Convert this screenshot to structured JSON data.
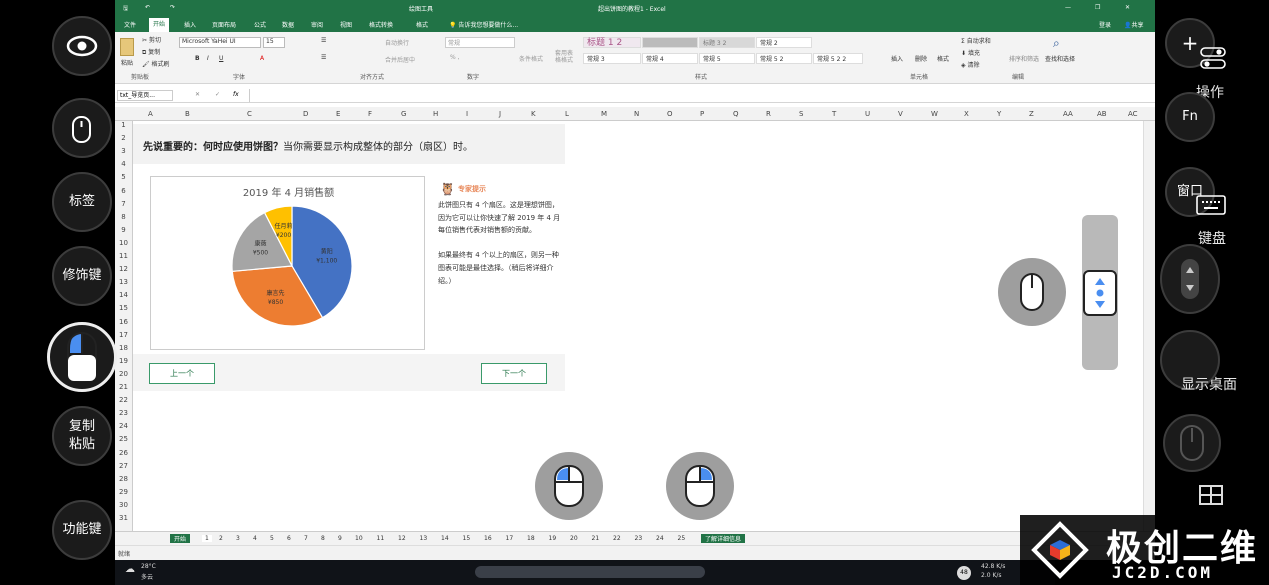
{
  "titlebar": {
    "context_tab": "绘图工具",
    "doc_title": "超出饼图的教程1 - Excel",
    "login": "登录",
    "share": "共享"
  },
  "ribbon_tabs": [
    "文件",
    "开始",
    "插入",
    "页面布局",
    "公式",
    "数据",
    "审阅",
    "视图",
    "格式转换",
    "格式"
  ],
  "tell_me": "告诉我您想要做什么...",
  "ribbon": {
    "clipboard": {
      "paste": "粘贴",
      "cut": "剪切",
      "copy": "复制",
      "format_painter": "格式刷",
      "label": "剪贴板"
    },
    "font": {
      "name": "Microsoft YaHei UI",
      "size": "15",
      "label": "字体"
    },
    "alignment": {
      "wrap": "自动换行",
      "merge": "合并后居中",
      "label": "对齐方式"
    },
    "number": {
      "format": "常规",
      "label": "数字"
    },
    "styles": {
      "conditional": "条件格式",
      "as_table": "套用表格格式",
      "cells": [
        "标题 1 2",
        "",
        "标题 3 2",
        "常规 2",
        "常规 3",
        "常规 4",
        "常规 5",
        "常规 5 2",
        "常规 5 2 2"
      ],
      "label": "样式"
    },
    "cells_group": {
      "insert": "插入",
      "delete": "删除",
      "format": "格式",
      "label": "单元格"
    },
    "editing": {
      "autosum": "自动求和",
      "fill": "填充",
      "clear": "清除",
      "sort": "排序和筛选",
      "find": "查找和选择",
      "label": "编辑"
    }
  },
  "formula_bar": {
    "name_box": "txt_导览页...",
    "fx": "fx"
  },
  "columns": [
    "A",
    "B",
    "C",
    "D",
    "E",
    "F",
    "G",
    "H",
    "I",
    "J",
    "K",
    "L",
    "M",
    "N",
    "O",
    "P",
    "Q",
    "R",
    "S",
    "T",
    "U",
    "V",
    "W",
    "X",
    "Y",
    "Z",
    "AA",
    "AB",
    "AC"
  ],
  "rows": [
    "1",
    "2",
    "3",
    "4",
    "5",
    "6",
    "7",
    "8",
    "9",
    "10",
    "11",
    "12",
    "13",
    "14",
    "15",
    "16",
    "17",
    "18",
    "19",
    "20",
    "21",
    "22",
    "23",
    "24",
    "25",
    "26",
    "27",
    "28",
    "29",
    "30",
    "31"
  ],
  "heading": {
    "bold": "先说重要的：何时应使用饼图？",
    "rest": "当你需要显示构成整体的部分（扇区）时。"
  },
  "tip": {
    "title": "专家提示",
    "para1": "此饼图只有 4 个扇区。这是理想饼图，因为它可以让你快速了解 2019 年 4 月每位销售代表对销售额的贡献。",
    "para2": "如果最终有 4 个以上的扇区，则另一种图表可能是最佳选择。（稍后将详细介绍。）"
  },
  "nav": {
    "prev": "上一个",
    "next": "下一个"
  },
  "chart_data": {
    "type": "pie",
    "title": "2019 年 4 月销售额",
    "slices": [
      {
        "name": "黄阳",
        "label": "¥1,100",
        "value": 1100,
        "color": "#4472c4"
      },
      {
        "name": "康言先",
        "label": "¥850",
        "value": 850,
        "color": "#ed7d31"
      },
      {
        "name": "康薇",
        "label": "¥500",
        "value": 500,
        "color": "#a5a5a5"
      },
      {
        "name": "任月莉",
        "label": "¥200",
        "value": 200,
        "color": "#ffc000"
      }
    ]
  },
  "sheet_tabs": [
    "开始",
    "1",
    "2",
    "3",
    "4",
    "5",
    "6",
    "7",
    "8",
    "9",
    "10",
    "11",
    "12",
    "13",
    "14",
    "15",
    "16",
    "17",
    "18",
    "19",
    "20",
    "21",
    "22",
    "23",
    "24",
    "25",
    "了解详细信息"
  ],
  "status": {
    "ready": "就绪"
  },
  "taskbar": {
    "temp": "28°C",
    "weather": "多云",
    "net_up": "42.8 K/s",
    "net_down": "2.0 K/s",
    "badge": "48"
  },
  "left_controls": [
    {
      "name": "eye-button",
      "label": ""
    },
    {
      "name": "mouse-button",
      "label": ""
    },
    {
      "name": "label-button",
      "label": "标签"
    },
    {
      "name": "modifier-button",
      "label": "修饰键"
    },
    {
      "name": "mouse-left-button",
      "label": ""
    },
    {
      "name": "copy-paste-button",
      "label": "复制\n粘贴"
    },
    {
      "name": "function-button",
      "label": "功能键"
    }
  ],
  "right_controls": {
    "operate": "操作",
    "fn": "Fn",
    "window": "窗口",
    "keyboard": "键盘",
    "show_desktop": "显示桌面"
  },
  "watermark": {
    "brand": "极创二维",
    "domain": "JC2D.COM"
  },
  "colors": {
    "excel_green": "#217346",
    "accent_blue": "#4a8ef0"
  }
}
